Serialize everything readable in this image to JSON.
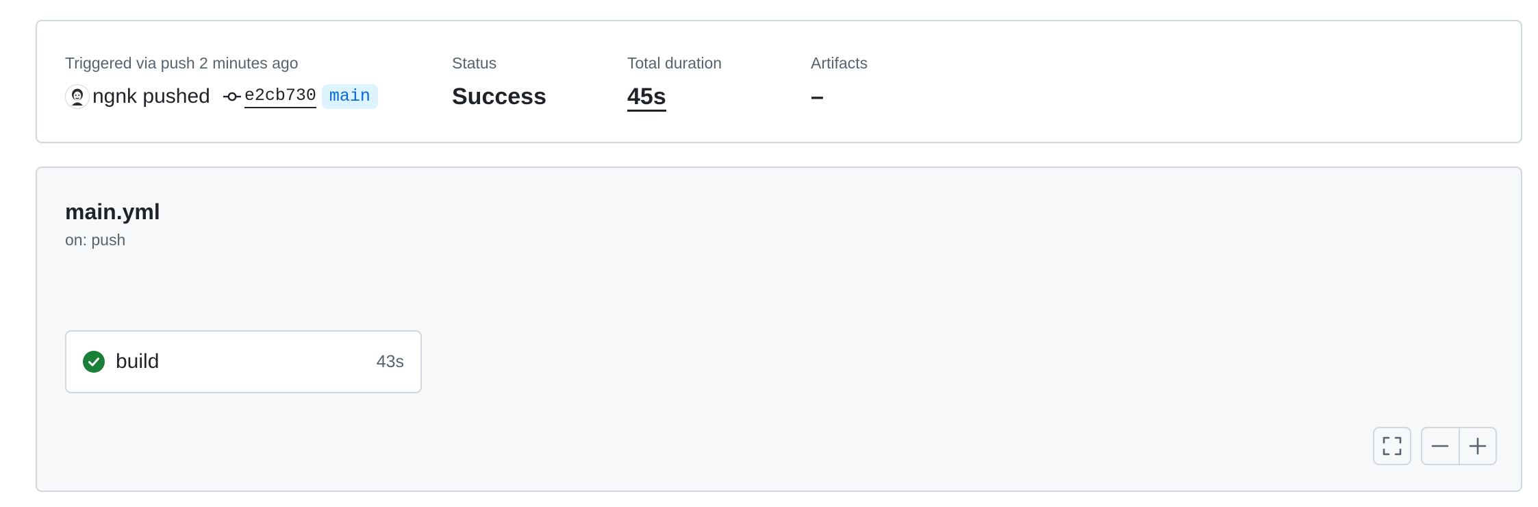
{
  "summary": {
    "trigger": {
      "label": "Triggered via push 2 minutes ago",
      "actor_text": "ngnk pushed",
      "commit_sha": "e2cb730",
      "branch": "main"
    },
    "status": {
      "label": "Status",
      "value": "Success"
    },
    "duration": {
      "label": "Total duration",
      "value": "45s"
    },
    "artifacts": {
      "label": "Artifacts",
      "value": "–"
    }
  },
  "workflow": {
    "file": "main.yml",
    "event": "on: push",
    "jobs": [
      {
        "name": "build",
        "duration": "43s",
        "status": "success",
        "icon": "check-circle-icon"
      }
    ],
    "controls": {
      "fullscreen_icon": "fullscreen-icon",
      "zoom_out_icon": "zoom-out-icon",
      "zoom_in_icon": "zoom-in-icon"
    }
  },
  "colors": {
    "success": "#1a7f37",
    "branch_bg": "#ddf4ff",
    "branch_fg": "#0969da",
    "border": "#d0d7de",
    "muted": "#59636e"
  }
}
